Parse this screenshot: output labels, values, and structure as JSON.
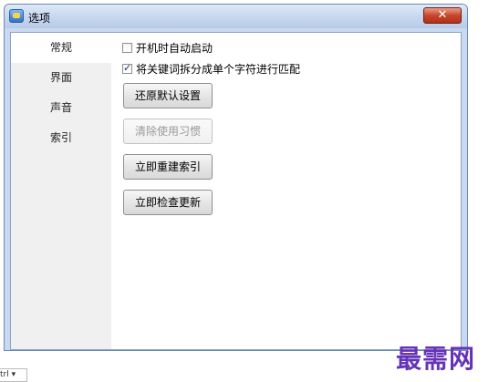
{
  "window": {
    "title": "选项",
    "close_symbol": "✕"
  },
  "sidebar": {
    "items": [
      {
        "label": "常规",
        "active": true
      },
      {
        "label": "界面",
        "active": false
      },
      {
        "label": "声音",
        "active": false
      },
      {
        "label": "索引",
        "active": false
      }
    ]
  },
  "general": {
    "autostart_label": "开机时自动启动",
    "autostart_checked": false,
    "split_keywords_label": "将关键词拆分成单个字符进行匹配",
    "split_keywords_checked": true,
    "restore_defaults_label": "还原默认设置",
    "clear_habits_label": "清除使用习惯",
    "rebuild_index_label": "立即重建索引",
    "check_update_label": "立即检查更新"
  },
  "watermark": "最需网",
  "bottom_dropdown": "trl ▾"
}
